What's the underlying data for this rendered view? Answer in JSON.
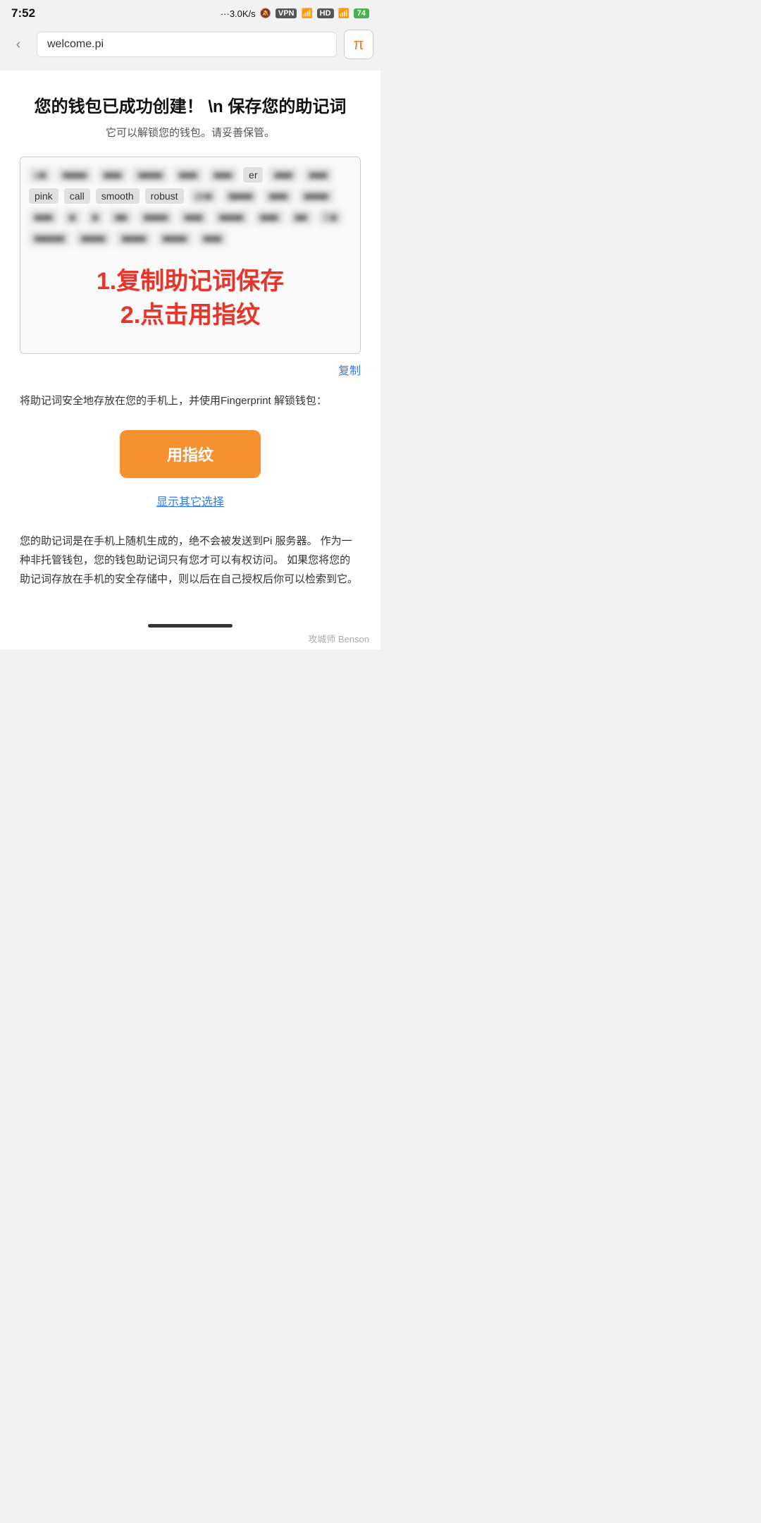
{
  "statusBar": {
    "time": "7:52",
    "network": "···3.0K/s",
    "vpn": "VPN",
    "signal1": "4G",
    "signal2": "4G",
    "battery": "74"
  },
  "addressBar": {
    "backIcon": "‹",
    "url": "welcome.pi",
    "piIcon": "π"
  },
  "page": {
    "title": "您的钱包已成功创建！ \\n 保存您的助记词",
    "subtitle": "它可以解锁您的钱包。请妥善保管。",
    "mnemonicWords": [
      {
        "text": "e■",
        "visible": false
      },
      {
        "text": "■■■■",
        "visible": false
      },
      {
        "text": "■■■",
        "visible": false
      },
      {
        "text": "■■■■",
        "visible": false
      },
      {
        "text": "■■■",
        "visible": false
      },
      {
        "text": "■■■",
        "visible": false
      },
      {
        "text": "er",
        "visible": true
      },
      {
        "text": "■■■",
        "visible": false
      },
      {
        "text": "■■■",
        "visible": false
      },
      {
        "text": "pink",
        "visible": true
      },
      {
        "text": "call",
        "visible": true
      },
      {
        "text": "smooth",
        "visible": true
      },
      {
        "text": "robust",
        "visible": true
      },
      {
        "text": "de■",
        "visible": false
      },
      {
        "text": "■■■■",
        "visible": false
      },
      {
        "text": "■■■",
        "visible": false
      },
      {
        "text": "■■■■",
        "visible": false
      },
      {
        "text": "■■■",
        "visible": false
      },
      {
        "text": "■",
        "visible": false
      },
      {
        "text": "■",
        "visible": false
      },
      {
        "text": "■■",
        "visible": false
      },
      {
        "text": "■■■■",
        "visible": false
      },
      {
        "text": "■■■",
        "visible": false
      },
      {
        "text": "■■■■",
        "visible": false
      },
      {
        "text": "■■■",
        "visible": false
      },
      {
        "text": "■■",
        "visible": false
      },
      {
        "text": "C■",
        "visible": false
      },
      {
        "text": "■■■■■",
        "visible": false
      },
      {
        "text": "■■■■",
        "visible": false
      },
      {
        "text": "■■■■",
        "visible": false
      },
      {
        "text": "■■■■",
        "visible": false
      },
      {
        "text": "■■■",
        "visible": false
      }
    ],
    "overlayLines": [
      "1.复制助记词保存",
      "2.点击用指纹"
    ],
    "copyLinkText": "复制",
    "fingerprintDesc": "将助记词安全地存放在您的手机上，并使用Fingerprint 解锁钱包：",
    "fingerprintBtnLabel": "用指纹",
    "showOptionsLinkText": "显示其它选择",
    "bottomDesc": "您的助记词是在手机上随机生成的，绝不会被发送到Pi 服务器。 作为一种非托管钱包，您的钱包助记词只有您才可以有权访问。 如果您将您的助记词存放在手机的安全存储中，则以后在自己授权后你可以检索到它。"
  },
  "watermark": "攻城师 Benson"
}
